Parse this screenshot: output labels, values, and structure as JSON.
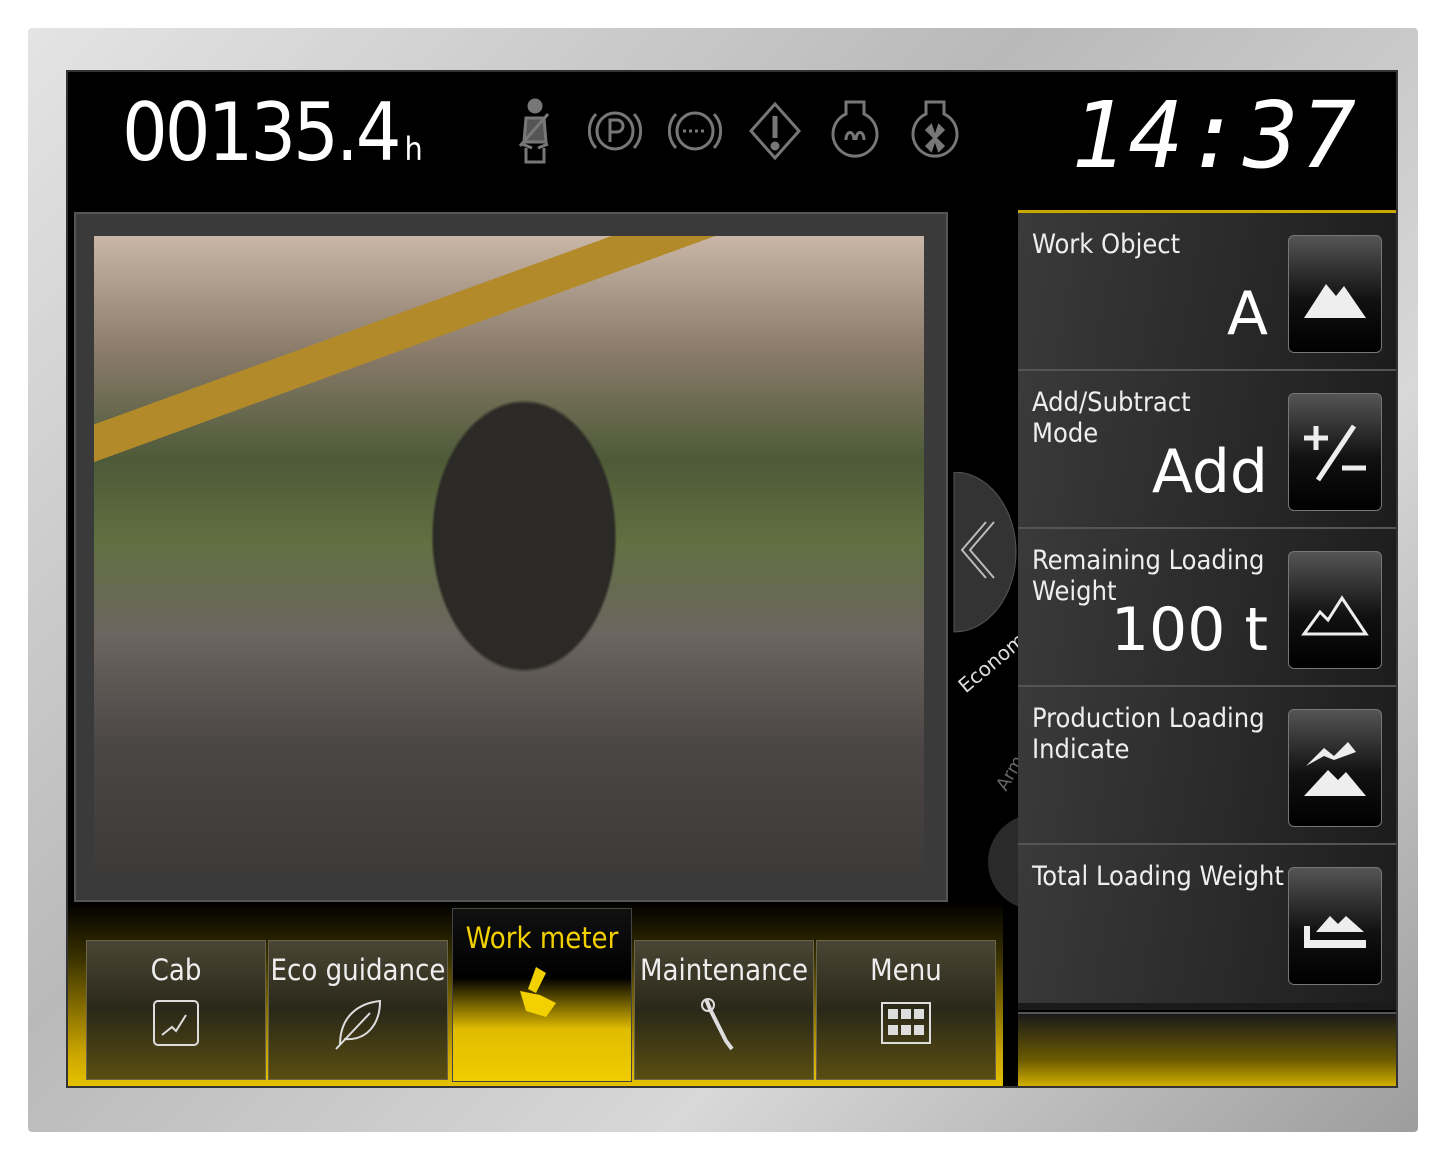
{
  "header": {
    "hours_value": "00135.4",
    "hours_unit": "h",
    "clock": "14:37",
    "indicators": [
      "seatbelt-icon",
      "parking-brake-icon",
      "brake-warning-icon",
      "warning-diamond-icon",
      "glow-plug-icon",
      "fan-icon"
    ]
  },
  "camera": {
    "description_icon": "camera-feed"
  },
  "side_modes": {
    "economy": "Economy mode",
    "arm_crane": "Arm Crane mode"
  },
  "panel": [
    {
      "label": "Work Object",
      "value": "A",
      "icon": "mountain-icon"
    },
    {
      "label": "Add/Subtract Mode",
      "value": "Add",
      "icon": "plus-minus-icon"
    },
    {
      "label": "Remaining Loading Weight",
      "value": "100 t",
      "icon": "mountain-outline-icon"
    },
    {
      "label": "Production Loading Indicate",
      "value": "",
      "icon": "excavator-load-icon"
    },
    {
      "label": "Total Loading Weight",
      "value": "",
      "icon": "truck-load-icon"
    }
  ],
  "tabs": [
    {
      "label": "Cab",
      "icon": "cab-chart-icon"
    },
    {
      "label": "Eco guidance",
      "icon": "leaf-icon"
    },
    {
      "label": "Work meter",
      "icon": "excavator-icon",
      "active": true
    },
    {
      "label": "Maintenance",
      "icon": "wrench-icon"
    },
    {
      "label": "Menu",
      "icon": "grid-icon"
    }
  ],
  "colors": {
    "accent": "#e8c400",
    "background": "#000000",
    "active_tab_text": "#f3d000"
  }
}
